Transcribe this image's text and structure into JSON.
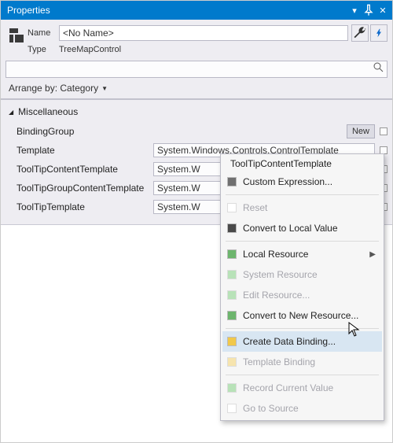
{
  "titlebar": {
    "title": "Properties"
  },
  "header": {
    "name_label": "Name",
    "name_value": "<No Name>",
    "type_label": "Type",
    "type_value": "TreeMapControl"
  },
  "arrange": {
    "label": "Arrange by:",
    "mode": "Category"
  },
  "category": {
    "name": "Miscellaneous"
  },
  "props": [
    {
      "label": "BindingGroup",
      "kind": "new",
      "button": "New"
    },
    {
      "label": "Template",
      "kind": "text",
      "value": "System.Windows.Controls.ControlTemplate"
    },
    {
      "label": "ToolTipContentTemplate",
      "kind": "text",
      "value": "System.W"
    },
    {
      "label": "ToolTipGroupContentTemplate",
      "kind": "text",
      "value": "System.W"
    },
    {
      "label": "ToolTipTemplate",
      "kind": "text",
      "value": "System.W"
    }
  ],
  "menu": {
    "title": "ToolTipContentTemplate",
    "items": [
      {
        "label": "Custom Expression...",
        "sw": "sw-gray",
        "enabled": true
      },
      {
        "sep": true
      },
      {
        "label": "Reset",
        "sw": "sw-lempty",
        "enabled": false
      },
      {
        "label": "Convert to Local Value",
        "sw": "sw-dark",
        "enabled": true
      },
      {
        "sep": true
      },
      {
        "label": "Local Resource",
        "sw": "sw-green",
        "enabled": true,
        "submenu": true
      },
      {
        "label": "System Resource",
        "sw": "sw-lgreen",
        "enabled": false
      },
      {
        "label": "Edit Resource...",
        "sw": "sw-lgreen",
        "enabled": false
      },
      {
        "label": "Convert to New Resource...",
        "sw": "sw-green",
        "enabled": true
      },
      {
        "sep": true
      },
      {
        "label": "Create Data Binding...",
        "sw": "sw-amber",
        "enabled": true,
        "hover": true
      },
      {
        "label": "Template Binding",
        "sw": "sw-lamber",
        "enabled": false
      },
      {
        "sep": true
      },
      {
        "label": "Record Current Value",
        "sw": "sw-lgreen",
        "enabled": false
      },
      {
        "label": "Go to Source",
        "sw": "sw-lempty",
        "enabled": false
      }
    ]
  }
}
